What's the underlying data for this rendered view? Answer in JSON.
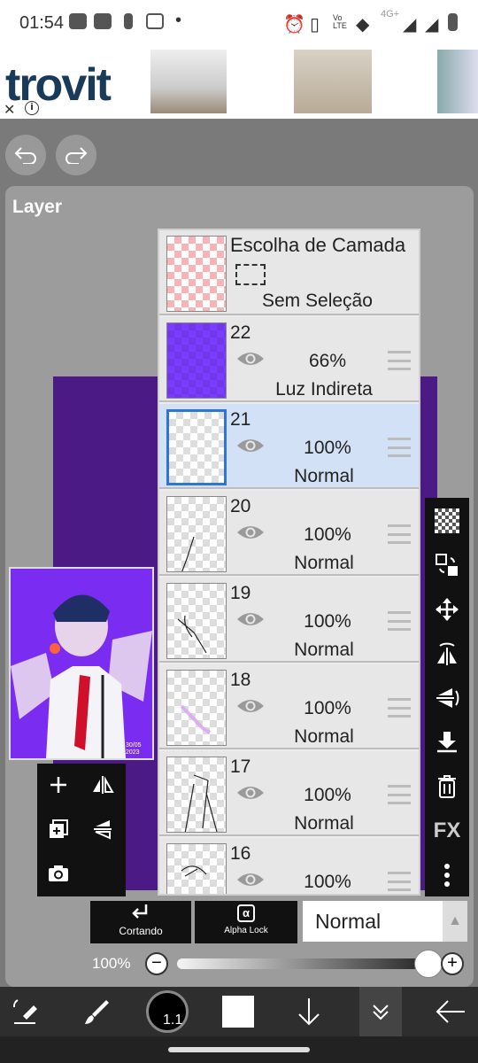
{
  "status_bar": {
    "time": "01:54",
    "dot": "•",
    "network": "4G+",
    "volte": "Vo LTE"
  },
  "ad": {
    "brand": "trovit",
    "close": "✕",
    "info": "i"
  },
  "panel": {
    "title": "Layer"
  },
  "layer_selection": {
    "title": "Escolha de Camada",
    "subtitle": "Sem Seleção"
  },
  "layers": [
    {
      "num": "22",
      "opacity": "66%",
      "blend": "Luz Indireta",
      "color": "#7b3cff",
      "selected": false
    },
    {
      "num": "21",
      "opacity": "100%",
      "blend": "Normal",
      "selected": true
    },
    {
      "num": "20",
      "opacity": "100%",
      "blend": "Normal",
      "selected": false
    },
    {
      "num": "19",
      "opacity": "100%",
      "blend": "Normal",
      "selected": false
    },
    {
      "num": "18",
      "opacity": "100%",
      "blend": "Normal",
      "selected": false
    },
    {
      "num": "17",
      "opacity": "100%",
      "blend": "Normal",
      "selected": false
    },
    {
      "num": "16",
      "opacity": "100%",
      "blend": "",
      "selected": false
    }
  ],
  "bottom_controls": {
    "clipping": "Cortando",
    "alpha_lock": "Alpha Lock",
    "alpha_icon": "α",
    "blend_mode": "Normal"
  },
  "opacity": {
    "label": "100%",
    "minus": "−",
    "plus": "+",
    "value": 1.0
  },
  "right_toolbar": {
    "fx": "FX"
  },
  "brush": {
    "size": "1.1"
  },
  "thumbnail": {
    "signature": "30/05 2023"
  },
  "colors": {
    "accent": "#2f75d6",
    "purple": "#7b3cff",
    "selected_row": "#d3e1f6"
  }
}
